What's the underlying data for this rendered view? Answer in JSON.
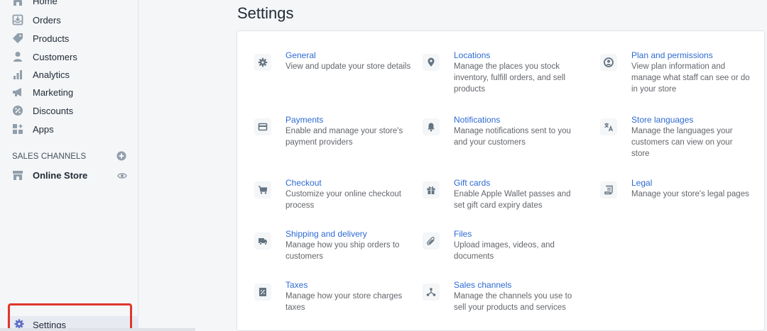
{
  "sidebar": {
    "items": [
      {
        "label": "Home",
        "icon": "home-icon"
      },
      {
        "label": "Orders",
        "icon": "inbox-icon"
      },
      {
        "label": "Products",
        "icon": "tag-icon"
      },
      {
        "label": "Customers",
        "icon": "person-icon"
      },
      {
        "label": "Analytics",
        "icon": "bar-chart-icon"
      },
      {
        "label": "Marketing",
        "icon": "megaphone-icon"
      },
      {
        "label": "Discounts",
        "icon": "discount-icon"
      },
      {
        "label": "Apps",
        "icon": "apps-icon"
      }
    ],
    "sales_channels_title": "SALES CHANNELS",
    "online_store_label": "Online Store",
    "settings_label": "Settings"
  },
  "main": {
    "title": "Settings",
    "settings": [
      {
        "title": "General",
        "desc": "View and update your store details",
        "icon": "gear-icon"
      },
      {
        "title": "Locations",
        "desc": "Manage the places you stock inventory, fulfill orders, and sell products",
        "icon": "location-pin-icon"
      },
      {
        "title": "Plan and permissions",
        "desc": "View plan information and manage what staff can see or do in your store",
        "icon": "user-circle-icon"
      },
      {
        "title": "Payments",
        "desc": "Enable and manage your store's payment providers",
        "icon": "credit-card-icon"
      },
      {
        "title": "Notifications",
        "desc": "Manage notifications sent to you and your customers",
        "icon": "bell-icon"
      },
      {
        "title": "Store languages",
        "desc": "Manage the languages your customers can view on your store",
        "icon": "translate-icon"
      },
      {
        "title": "Checkout",
        "desc": "Customize your online checkout process",
        "icon": "cart-icon"
      },
      {
        "title": "Gift cards",
        "desc": "Enable Apple Wallet passes and set gift card expiry dates",
        "icon": "gift-icon"
      },
      {
        "title": "Legal",
        "desc": "Manage your store's legal pages",
        "icon": "document-icon"
      },
      {
        "title": "Shipping and delivery",
        "desc": "Manage how you ship orders to customers",
        "icon": "truck-icon"
      },
      {
        "title": "Files",
        "desc": "Upload images, videos, and documents",
        "icon": "paperclip-icon"
      },
      {
        "title": "Taxes",
        "desc": "Manage how your store charges taxes",
        "icon": "tax-icon"
      },
      {
        "title": "Sales channels",
        "desc": "Manage the channels you use to sell your products and services",
        "icon": "channels-icon"
      }
    ]
  },
  "colors": {
    "link": "#2e6ad1",
    "highlight": "#e0372b",
    "icon": "#5c6ac4"
  }
}
